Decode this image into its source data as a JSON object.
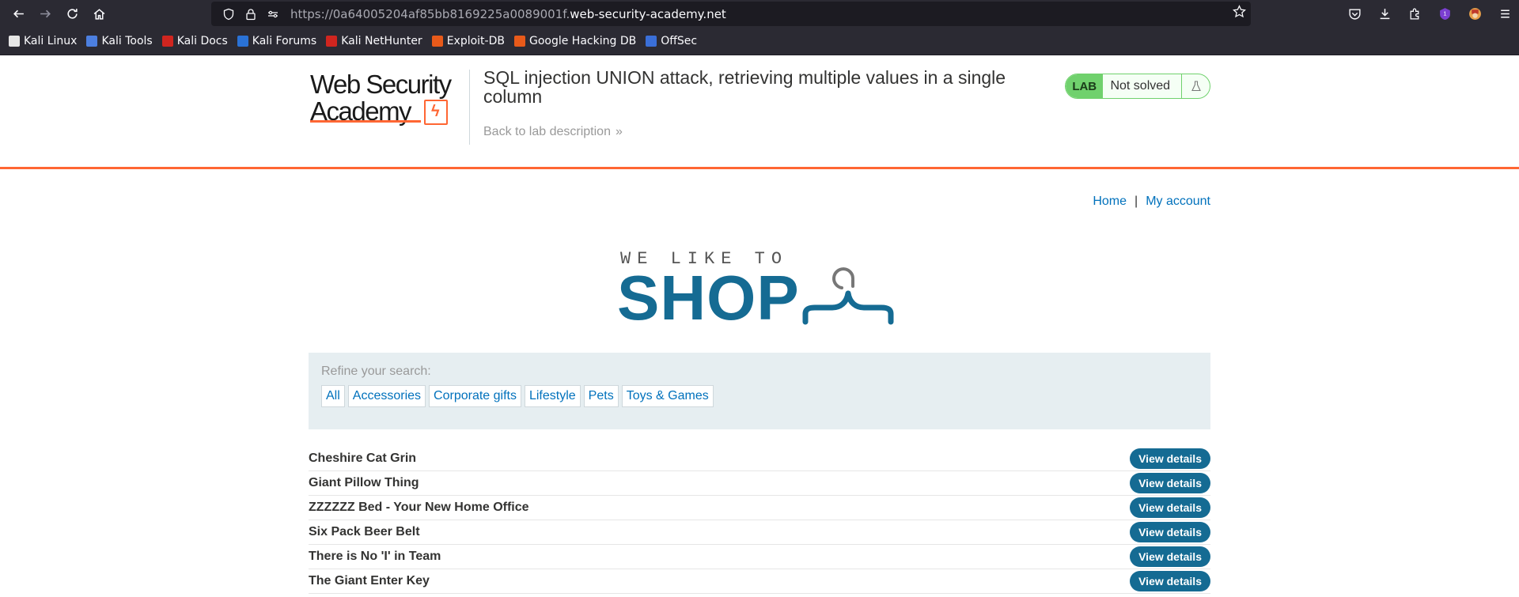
{
  "browser": {
    "url_prefix": "https://0a64005204af85bb8169225a0089001f.",
    "url_host": "web-security-academy.net",
    "bookmarks": [
      {
        "label": "Kali Linux",
        "color": "#e6e6e6"
      },
      {
        "label": "Kali Tools",
        "color": "#4c7fe0"
      },
      {
        "label": "Kali Docs",
        "color": "#d0251f"
      },
      {
        "label": "Kali Forums",
        "color": "#2a72d6"
      },
      {
        "label": "Kali NetHunter",
        "color": "#d0251f"
      },
      {
        "label": "Exploit-DB",
        "color": "#e85a1a"
      },
      {
        "label": "Google Hacking DB",
        "color": "#e85a1a"
      },
      {
        "label": "OffSec",
        "color": "#3a6fd8"
      }
    ]
  },
  "lab": {
    "logo_line1": "Web Security",
    "logo_line2": "Academy",
    "title": "SQL injection UNION attack, retrieving multiple values in a single column",
    "back_link": "Back to lab description",
    "badge": "LAB",
    "status": "Not solved"
  },
  "nav": {
    "home": "Home",
    "separator": "|",
    "account": "My account"
  },
  "banner": {
    "top": "WE LIKE TO",
    "main": "SHOP"
  },
  "refine": {
    "label": "Refine your search:",
    "categories": [
      "All",
      "Accessories",
      "Corporate gifts",
      "Lifestyle",
      "Pets",
      "Toys & Games"
    ]
  },
  "products": {
    "button_label": "View details",
    "items": [
      "Cheshire Cat Grin",
      "Giant Pillow Thing",
      "ZZZZZZ Bed - Your New Home Office",
      "Six Pack Beer Belt",
      "There is No 'I' in Team",
      "The Giant Enter Key"
    ]
  },
  "colors": {
    "accent_orange": "#ff6633",
    "brand_blue": "#156b93",
    "link_blue": "#0071bc",
    "lab_green": "#70d16d"
  }
}
